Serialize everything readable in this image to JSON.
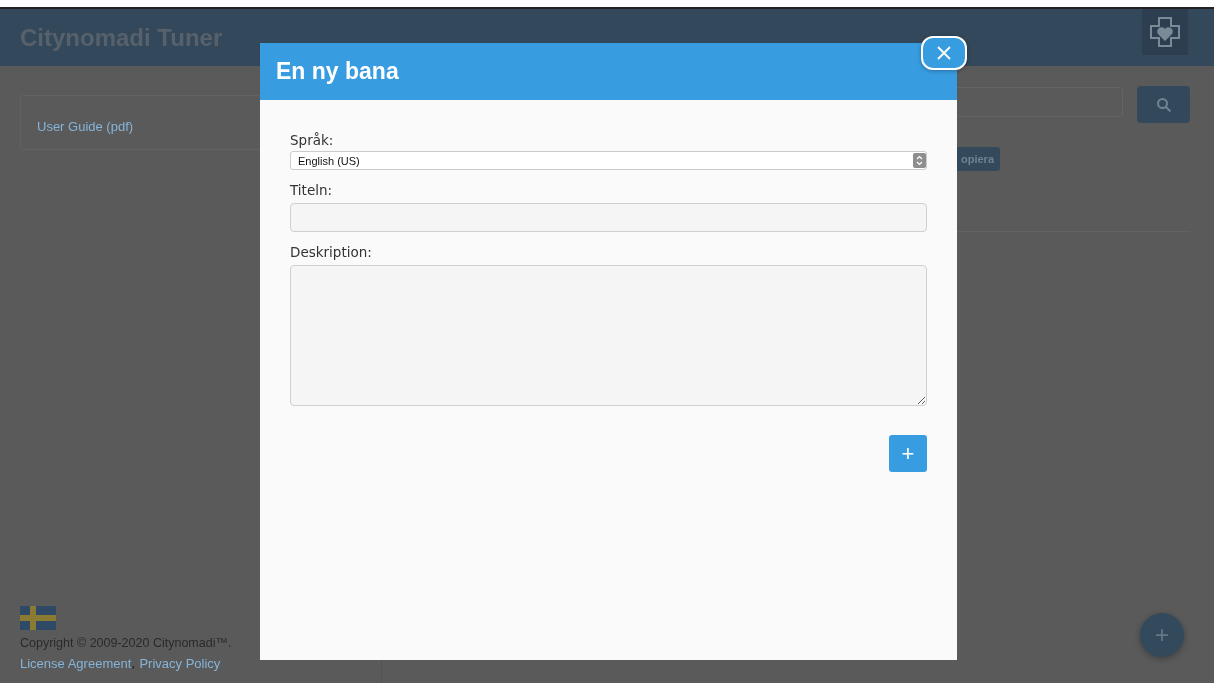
{
  "header": {
    "title": "Citynomadi Tuner"
  },
  "sidebar": {
    "links": [
      "User Guide (pdf)"
    ]
  },
  "footer": {
    "copyright": "Copyright © 2009-2020 Citynomadi™.",
    "links": [
      "License Agreement",
      "Privacy Policy"
    ],
    "separator": ","
  },
  "toolbar": {
    "copy_button": "opiera"
  },
  "fab": {
    "label": "+"
  },
  "modal": {
    "title": "En ny bana",
    "fields": [
      {
        "kind": "select",
        "label": "Språk:",
        "value": "English (US)"
      },
      {
        "kind": "text",
        "label": "Titeln:"
      },
      {
        "kind": "textarea",
        "label": "Deskription:"
      }
    ],
    "add_button": "+"
  }
}
